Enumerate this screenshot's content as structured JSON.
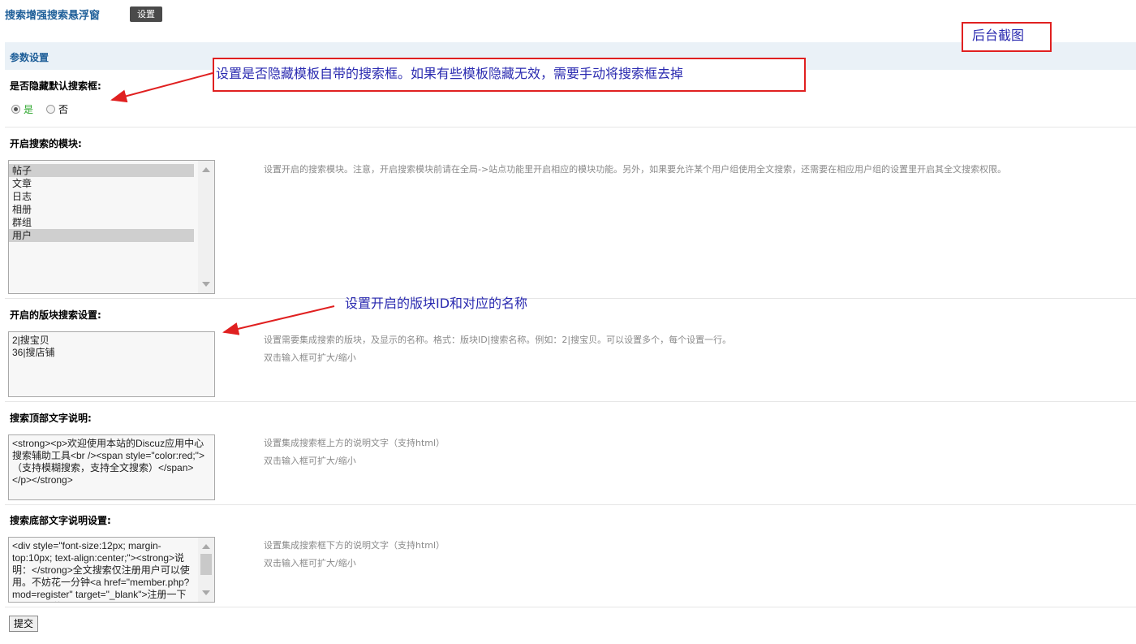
{
  "header": {
    "title": "搜索增强搜索悬浮窗",
    "settings_button": "设置"
  },
  "annotation_screenshot": "后台截图",
  "section": {
    "title": "参数设置"
  },
  "hide_search": {
    "label": "是否隐藏默认搜索框:",
    "option_yes": "是",
    "option_no": "否",
    "selected": "是",
    "annotation": "设置是否隐藏模板自带的搜索框。如果有些模板隐藏无效，需要手动将搜索框去掉"
  },
  "modules": {
    "label": "开启搜索的模块:",
    "items": [
      {
        "label": "帖子",
        "selected": true
      },
      {
        "label": "文章",
        "selected": false
      },
      {
        "label": "日志",
        "selected": false
      },
      {
        "label": "相册",
        "selected": false
      },
      {
        "label": "群组",
        "selected": false
      },
      {
        "label": "用户",
        "selected": true
      }
    ],
    "description": "设置开启的搜索模块。注意，开启搜索模块前请在全局->站点功能里开启相应的模块功能。另外，如果要允许某个用户组使用全文搜索，还需要在相应用户组的设置里开启其全文搜索权限。"
  },
  "forum_search": {
    "label": "开启的版块搜索设置:",
    "value": "2|搜宝贝\n36|搜店铺",
    "description": "设置需要集成搜索的版块，及显示的名称。格式：版块ID|搜索名称。例如：2|搜宝贝。可以设置多个，每个设置一行。",
    "hint": "双击输入框可扩大/缩小",
    "annotation": "设置开启的版块ID和对应的名称"
  },
  "top_text": {
    "label": "搜索顶部文字说明:",
    "value": "<strong><p>欢迎使用本站的Discuz应用中心搜索辅助工具<br /><span style=\"color:red;\">（支持模糊搜索，支持全文搜索）</span></p></strong>",
    "description": "设置集成搜索框上方的说明文字（支持html）",
    "hint": "双击输入框可扩大/缩小"
  },
  "bottom_text": {
    "label": "搜索底部文字说明设置:",
    "value": "<div style=\"font-size:12px; margin-top:10px; text-align:center;\"><strong>说明：</strong>全文搜索仅注册用户可以使用。不妨花一分钟<a href=\"member.php?mod=register\" target=\"_blank\">注册一下</a>吧，说",
    "description": "设置集成搜索框下方的说明文字（支持html）",
    "hint": "双击输入框可扩大/缩小"
  },
  "submit_label": "提交"
}
